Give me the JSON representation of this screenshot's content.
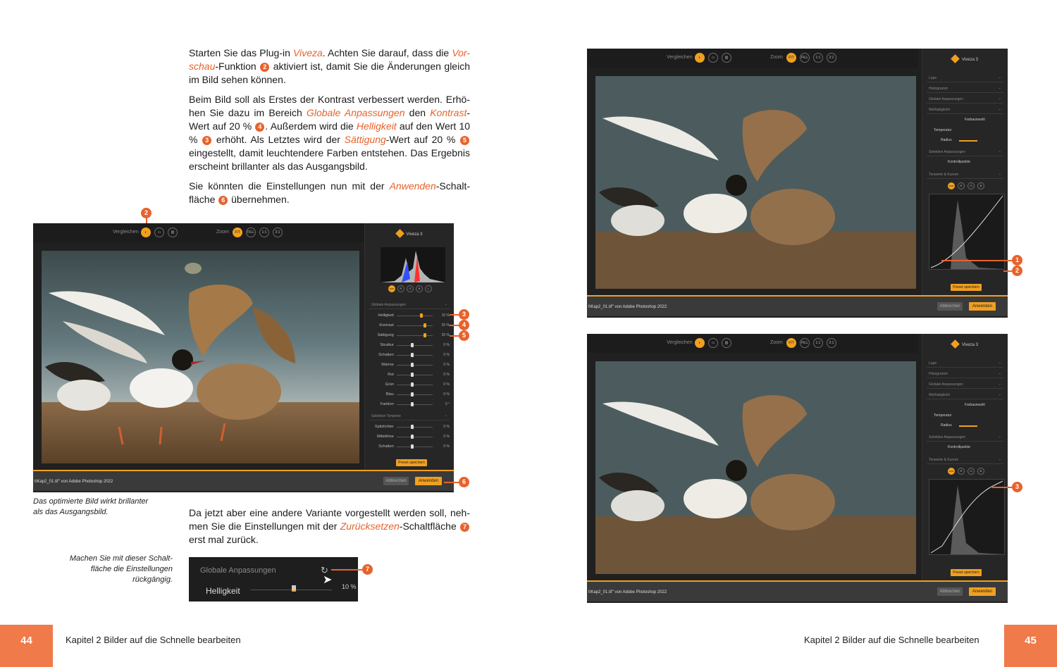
{
  "left_text": {
    "p1": {
      "a": "Starten Sie das Plug-in ",
      "b": "Viveza",
      "c": ". Achten Sie darauf, dass die ",
      "d": "Vor-schau",
      "e": "-Funktion ",
      "n": "2",
      "f": " aktiviert ist, damit Sie die Änderungen gleich im Bild sehen können."
    },
    "p2": {
      "a": "Beim Bild soll als Erstes der Kontrast verbessert werden. Erhö-hen Sie dazu im Bereich ",
      "b": "Globale Anpassungen",
      "c": " den ",
      "d": "Kontrast",
      "e": "-Wert auf 20 % ",
      "n1": "4",
      "f": ". Außerdem wird die ",
      "g": "Helligkeit",
      "h": " auf den Wert 10 % ",
      "n2": "3",
      "i": " erhöht. Als Letztes wird der ",
      "j": "Sättigung",
      "k": "-Wert auf 20 % ",
      "n3": "5",
      "l": " eingestellt, damit leuchtendere Farben entstehen. Das Ergebnis erscheint brillanter als das Ausgangsbild."
    },
    "p3": {
      "a": "Sie könnten die Einstellungen nun mit der ",
      "b": "Anwenden",
      "c": "-Schalt-fläche ",
      "n": "6",
      "d": " übernehmen."
    },
    "p4": {
      "a": "Da jetzt aber eine andere Variante vorgestellt werden soll, neh-men Sie die Einstellungen mit der ",
      "b": "Zurücksetzen",
      "c": "-Schaltfläche ",
      "n": "7",
      "d": " erst mal zurück."
    }
  },
  "captions": {
    "c1_l1": "Das optimierte Bild wirkt brillanter",
    "c1_l2": "als das Ausgangsbild.",
    "c2_l1": "Machen Sie mit dieser Schalt-",
    "c2_l2": "fläche die Einstellungen",
    "c2_l3": "rückgängig."
  },
  "app": {
    "compare_label": "Vergleichen",
    "zoom_label": "Zoom",
    "zoom_fit": "FIT",
    "zoom_fill": "FILL",
    "zoom_1": "1:1",
    "zoom_2": "2:1",
    "panel_title": "Viveza 3",
    "sec_lupe": "Lupe",
    "sec_histogram": "Histogramm",
    "sec_global": "Globale Anpassungen",
    "sec_whitebal": "Weißabgleich",
    "farbauswahl": "Farbauswahl",
    "temperatur": "Temperatur",
    "radius": "Radius",
    "sec_selective": "Selektive Anpassungen",
    "kontrollpunkte": "Kontrollpunkte",
    "sec_tone": "Tonwerte & Kurven",
    "sec_selective_tone": "Selektive Tonwerte",
    "channels": [
      "RGB",
      "R",
      "G",
      "B",
      "L"
    ],
    "sliders": [
      {
        "label": "Helligkeit",
        "value": "10 %"
      },
      {
        "label": "Kontrast",
        "value": "20 %"
      },
      {
        "label": "Sättigung",
        "value": "20 %"
      },
      {
        "label": "Struktur",
        "value": "0 %"
      },
      {
        "label": "Schatten",
        "value": "0 %"
      },
      {
        "label": "Wärme",
        "value": "0 %"
      },
      {
        "label": "Rot",
        "value": "0 %"
      },
      {
        "label": "Grün",
        "value": "0 %"
      },
      {
        "label": "Blau",
        "value": "0 %"
      },
      {
        "label": "Farbton",
        "value": "0 °"
      }
    ],
    "tone_sliders": [
      {
        "label": "Spitzlichter",
        "value": "0 %"
      },
      {
        "label": "Mitteltöne",
        "value": "0 %"
      },
      {
        "label": "Schatten",
        "value": "0 %"
      }
    ],
    "preset_button": "Preset speichern",
    "status_text": "t\\Kap2_01.tif\" von Adobe Photoshop 2022",
    "cancel_button": "Abbrechen",
    "apply_button": "Anwenden"
  },
  "crop": {
    "section": "Globale Anpassungen",
    "slider_label": "Helligkeit",
    "slider_value": "10 %"
  },
  "callouts": {
    "c1": "1",
    "c2": "2",
    "c3": "3",
    "c4": "4",
    "c5": "5",
    "c6": "6",
    "c7": "7"
  },
  "footer": {
    "left_page": "44",
    "left_title": "Kapitel 2   Bilder auf die Schnelle bearbeiten",
    "right_title": "Kapitel 2   Bilder auf die Schnelle bearbeiten",
    "right_page": "45"
  },
  "colors": {
    "accent_orange": "#e8622c",
    "ui_yellow": "#f0a020",
    "ui_dark": "#202020"
  }
}
